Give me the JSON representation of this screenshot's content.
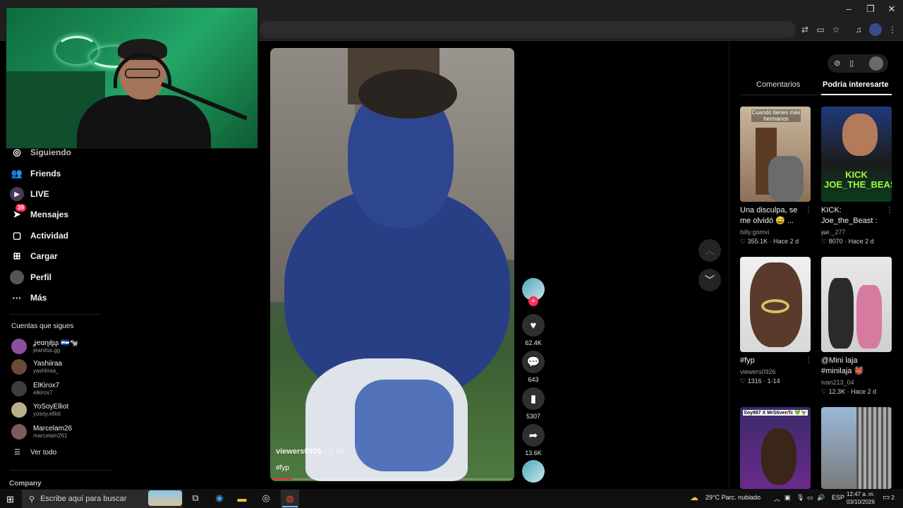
{
  "browser": {
    "window_controls": {
      "minimize": "–",
      "maximize": "❐",
      "close": "✕"
    },
    "toolbar_icons": [
      "translate-icon",
      "install-icon",
      "star-icon",
      "media-icon",
      "profile-icon",
      "menu-icon"
    ]
  },
  "sidebar": {
    "nav": [
      {
        "label": "Siguiendo",
        "icon": "following-icon"
      },
      {
        "label": "Friends",
        "icon": "friends-icon"
      },
      {
        "label": "LIVE",
        "icon": "live-icon"
      },
      {
        "label": "Mensajes",
        "icon": "messages-icon",
        "badge": "39"
      },
      {
        "label": "Actividad",
        "icon": "activity-icon"
      },
      {
        "label": "Cargar",
        "icon": "upload-icon"
      },
      {
        "label": "Perfil",
        "icon": "profile-icon"
      },
      {
        "label": "Más",
        "icon": "more-icon"
      }
    ],
    "following_title": "Cuentas que sigues",
    "accounts": [
      {
        "name": "ʝҽαɳιƚʂʂ 🇸🇻🐄",
        "handle": "jeanitss.gg",
        "color": "#8a4fa0"
      },
      {
        "name": "Yashiiraa",
        "handle": "yashiiraa_",
        "color": "#6b4a3a"
      },
      {
        "name": "ElKirox7",
        "handle": "elkirox7",
        "color": "#3d3d3d"
      },
      {
        "name": "YoSoyElliot",
        "handle": "yosoy.elliot",
        "color": "#b8b08a"
      },
      {
        "name": "Marcelam26",
        "handle": "marcelam261",
        "color": "#7a5a5a"
      }
    ],
    "see_all": "Ver todo",
    "footer": "Company"
  },
  "video": {
    "username": "viewers0926",
    "age": "· 2-25",
    "caption": "#fyp",
    "progress": 0.08
  },
  "actions": {
    "likes": "62.4K",
    "comments": "643",
    "saves": "5307",
    "shares": "13.6K"
  },
  "right_panel": {
    "tabs": [
      "Comentarios",
      "Podría interesarte"
    ],
    "recommendations": [
      {
        "title": "Una disculpa, se me olvidó 😅 ...",
        "user": "billy.gomvi",
        "likes": "355.1K",
        "time": "Hace 2 d",
        "overlay": "Cuando tienes más hermanos"
      },
      {
        "title": "KICK: Joe_the_Beast : ...",
        "user": "joe._277",
        "likes": "8070",
        "time": "Hace 2 d",
        "overlay": "KICK JOE_THE_BEAST"
      },
      {
        "title": "#fyp",
        "user": "viewers0926",
        "likes": "1316",
        "time": "1-14",
        "overlay": ""
      },
      {
        "title": "@Mini laja #minilaja 👹",
        "user": "ivan213_04",
        "likes": "12.3K",
        "time": "Hace 2 d",
        "overlay": ""
      },
      {
        "title": "",
        "user": "",
        "likes": "",
        "time": "",
        "overlay": "Soy887 X MrStivenTc 💚🦖"
      },
      {
        "title": "",
        "user": "",
        "likes": "",
        "time": "",
        "overlay": ""
      }
    ]
  },
  "taskbar": {
    "search_placeholder": "Escribe aquí para buscar",
    "weather": "29°C  Parc. nublado",
    "lang": "ESP",
    "time": "12:47 a. m.",
    "date": "03/10/2026",
    "notifications": "2"
  }
}
